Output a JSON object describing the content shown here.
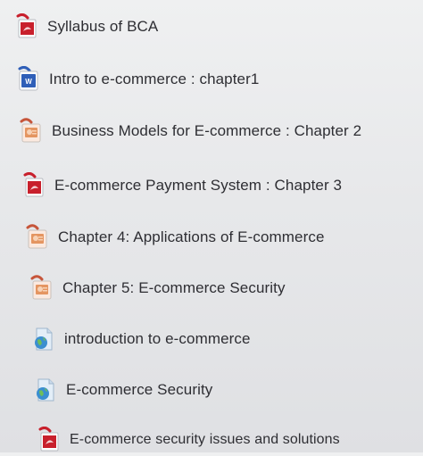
{
  "files": [
    {
      "label": "Syllabus of BCA",
      "icon": "pdf-icon"
    },
    {
      "label": "Intro to e-commerce : chapter1",
      "icon": "word-doc-icon"
    },
    {
      "label": "Business Models for E-commerce : Chapter 2",
      "icon": "powerpoint-icon"
    },
    {
      "label": "E-commerce Payment System : Chapter 3",
      "icon": "pdf-icon"
    },
    {
      "label": "Chapter 4: Applications of E-commerce",
      "icon": "powerpoint-icon"
    },
    {
      "label": "Chapter 5: E-commerce Security",
      "icon": "powerpoint-icon"
    },
    {
      "label": "introduction to e-commerce",
      "icon": "url-link-icon"
    },
    {
      "label": "E-commerce Security",
      "icon": "url-link-icon"
    },
    {
      "label": "E-commerce security issues and solutions",
      "icon": "pdf-icon"
    }
  ],
  "colors": {
    "pdf": "#c8202c",
    "word": "#2f5fb8",
    "powerpoint": "#d9703a",
    "url": "#3b8fd0",
    "text": "#2e2e33"
  }
}
